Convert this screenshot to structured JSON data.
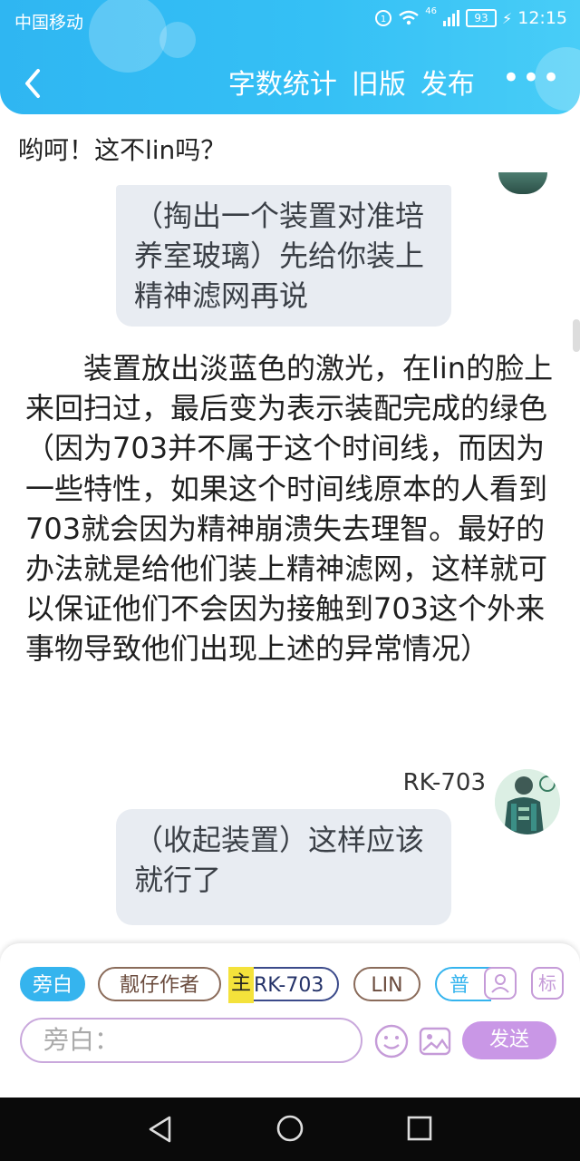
{
  "status_bar": {
    "carrier": "中国移动",
    "network": "46",
    "battery": "93",
    "time": "12:15"
  },
  "nav": {
    "word_count": "字数统计",
    "old_version": "旧版",
    "publish": "发布"
  },
  "chat": {
    "line1": "哟呵！这不lin吗？",
    "bubble1": "（掏出一个装置对准培养室玻璃）先给你装上精神滤网再说",
    "narration": "装置放出淡蓝色的激光，在lin的脸上来回扫过，最后变为表示装配完成的绿色（因为703并不属于这个时间线，而因为一些特性，如果这个时间线原本的人看到703就会因为精神崩溃失去理智。最好的办法就是给他们装上精神滤网，这样就可以保证他们不会因为接触到703这个外来事物导致他们出现上述的异常情况）",
    "speaker": "RK-703",
    "bubble2": "（收起装置）这样应该就行了"
  },
  "input_panel": {
    "chips": [
      {
        "label": "旁白"
      },
      {
        "label": "靓仔作者"
      },
      {
        "mark": "主",
        "label": "RK-703"
      },
      {
        "label": "LIN"
      },
      {
        "label": "普"
      }
    ],
    "tag_icon": "标",
    "placeholder": "旁白：",
    "send": "发送"
  },
  "colors": {
    "header_blue": "#35c0f5",
    "chip_active": "#35b4ee",
    "send_purple": "#c997e6",
    "bubble_gray": "#e8ecf2"
  },
  "icons": [
    "back-arrow-icon",
    "more-icon",
    "wifi-icon",
    "signal-icon",
    "emoji-icon",
    "image-icon",
    "person-icon",
    "back-triangle-icon",
    "home-circle-icon",
    "recent-square-icon"
  ]
}
